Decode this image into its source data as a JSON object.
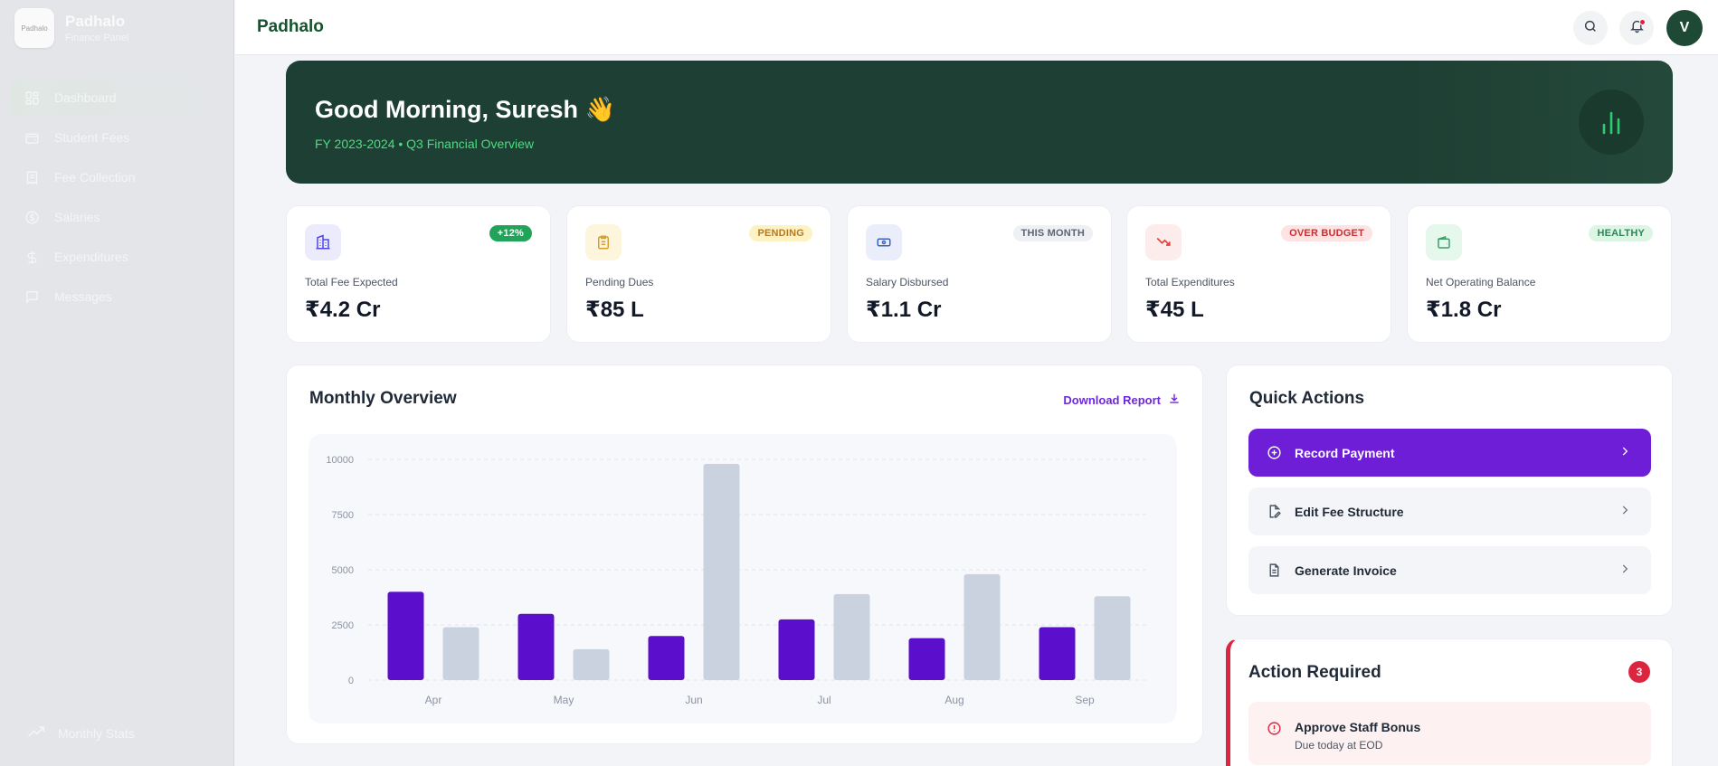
{
  "brand": {
    "logo_text": "Padhalo",
    "name": "Padhalo",
    "subtitle": "Finance Panel"
  },
  "sidebar": {
    "items": [
      {
        "label": "Dashboard",
        "icon": "dashboard-icon",
        "active": true
      },
      {
        "label": "Student Fees",
        "icon": "wallet-icon"
      },
      {
        "label": "Fee Collection",
        "icon": "receipt-icon"
      },
      {
        "label": "Salaries",
        "icon": "coin-icon"
      },
      {
        "label": "Expenditures",
        "icon": "dollar-icon"
      },
      {
        "label": "Messages",
        "icon": "message-icon"
      }
    ],
    "footer": {
      "label": "Monthly Stats",
      "icon": "trending-up-icon"
    }
  },
  "topbar": {
    "title": "Padhalo",
    "avatar_initial": "V"
  },
  "hero": {
    "greeting": "Good Morning, Suresh 👋",
    "subtitle": "FY 2023-2024 • Q3 Financial Overview"
  },
  "stats": [
    {
      "label": "Total Fee Expected",
      "value": "₹4.2 Cr",
      "badge": "+12%",
      "badge_bg": "#22a35a",
      "badge_fg": "#ffffff",
      "icon": "building-icon",
      "icon_bg": "#ecebfb",
      "icon_fg": "#4f46e5"
    },
    {
      "label": "Pending Dues",
      "value": "₹85 L",
      "badge": "PENDING",
      "badge_bg": "#fdf2c4",
      "badge_fg": "#b7791f",
      "icon": "clipboard-icon",
      "icon_bg": "#fdf6dc",
      "icon_fg": "#d69e2e"
    },
    {
      "label": "Salary Disbursed",
      "value": "₹1.1 Cr",
      "badge": "THIS MONTH",
      "badge_bg": "#eef0f4",
      "badge_fg": "#5b6473",
      "icon": "banknote-icon",
      "icon_bg": "#e9eefa",
      "icon_fg": "#3b63c4"
    },
    {
      "label": "Total Expenditures",
      "value": "₹45 L",
      "badge": "OVER BUDGET",
      "badge_bg": "#fde3e3",
      "badge_fg": "#c53030",
      "icon": "trending-down-icon",
      "icon_bg": "#fdecec",
      "icon_fg": "#e53e3e"
    },
    {
      "label": "Net Operating Balance",
      "value": "₹1.8 Cr",
      "badge": "HEALTHY",
      "badge_bg": "#dcf5e4",
      "badge_fg": "#2f855a",
      "icon": "wallet-icon",
      "icon_bg": "#e6f7ec",
      "icon_fg": "#38a169"
    }
  ],
  "overview": {
    "title": "Monthly Overview",
    "download_label": "Download Report"
  },
  "chart_data": {
    "type": "bar",
    "categories": [
      "Apr",
      "May",
      "Jun",
      "Jul",
      "Aug",
      "Sep"
    ],
    "series": [
      {
        "values": [
          4000,
          3000,
          2000,
          2750,
          1900,
          2400
        ],
        "color": "#5b0fcc"
      },
      {
        "values": [
          2400,
          1400,
          9800,
          3900,
          4800,
          3800
        ],
        "color": "#cbd2df"
      }
    ],
    "yticks": [
      0,
      2500,
      5000,
      7500,
      10000
    ],
    "ylim": [
      0,
      10000
    ],
    "grid": true
  },
  "quick_actions": {
    "title": "Quick Actions",
    "items": [
      {
        "label": "Record Payment",
        "icon": "plus-circle-icon",
        "primary": true
      },
      {
        "label": "Edit Fee Structure",
        "icon": "file-edit-icon"
      },
      {
        "label": "Generate Invoice",
        "icon": "file-text-icon"
      }
    ]
  },
  "action_required": {
    "title": "Action Required",
    "count": "3",
    "items": [
      {
        "title": "Approve Staff Bonus",
        "subtitle": "Due today at EOD",
        "icon": "alert-circle-icon"
      }
    ]
  }
}
